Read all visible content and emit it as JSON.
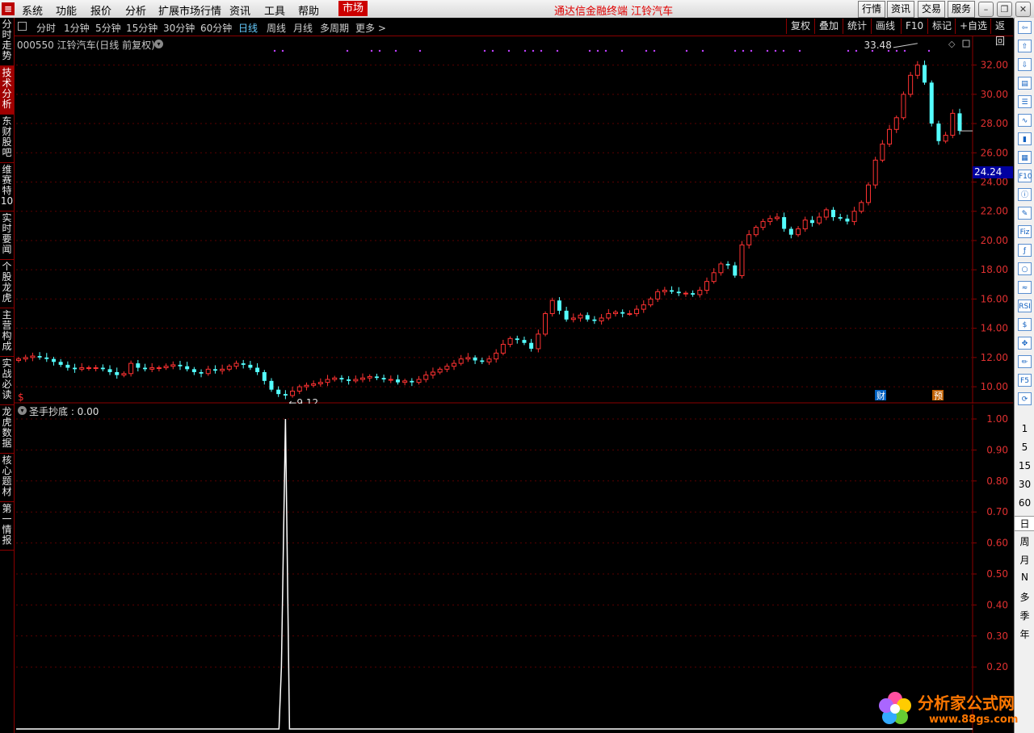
{
  "menubar": {
    "items": [
      "系统",
      "功能",
      "报价",
      "分析",
      "扩展市场行情",
      "资讯",
      "工具",
      "帮助"
    ],
    "market_tab": "市场",
    "app_title": "通达信金融终端  江铃汽车",
    "buttons": [
      "行情",
      "资讯",
      "交易",
      "服务"
    ]
  },
  "period_bar": {
    "items": [
      "分时",
      "1分钟",
      "5分钟",
      "15分钟",
      "30分钟",
      "60分钟",
      "日线",
      "周线",
      "月线",
      "多周期",
      "更多 >"
    ],
    "active": "日线",
    "right_tools": [
      "复权",
      "叠加",
      "统计",
      "画线",
      "F10",
      "标记",
      "+自选",
      "返回"
    ]
  },
  "left_tabs": [
    "分时走势",
    "技术分析",
    "东财股吧",
    "维赛特10",
    "实时要闻",
    "个股龙虎",
    "主营构成",
    "实战必读",
    "龙虎数据",
    "核心题材",
    "第一情报"
  ],
  "left_tabs_active": "技术分析",
  "stock": {
    "code_name": "000550 江铃汽车(日线 前复权)",
    "current_price_tag": "24.24",
    "high_label": "33.48",
    "low_label": "9.12",
    "markers": {
      "fin": "财",
      "pre": "预"
    },
    "dollar_icon": "$"
  },
  "indicator": {
    "title": "圣手抄底 : 0.00"
  },
  "right_toolbar": {
    "icons": [
      "back-arrow-icon",
      "up-arrow-icon",
      "down-arrow-icon",
      "report-icon",
      "list-icon",
      "chart-line-icon",
      "kline-icon",
      "grid-icon",
      "F10",
      "info-icon",
      "notes-icon",
      "Fiz",
      "fund-icon",
      "circle-icon",
      "wave-icon",
      "RSI",
      "dollar-icon",
      "move-icon",
      "pencil-icon",
      "F5",
      "refresh-icon"
    ],
    "periods": [
      "1",
      "5",
      "15",
      "30",
      "60",
      "日",
      "周",
      "月",
      "N",
      "多",
      "季",
      "年"
    ],
    "active_period": "日"
  },
  "watermark": {
    "text": "分析家公式网",
    "url": "www.88gs.com"
  },
  "chart_data": [
    {
      "type": "candlestick",
      "title": "000550 江铃汽车(日线 前复权)",
      "y_axis_ticks": [
        "32.00",
        "30.00",
        "28.00",
        "26.00",
        "24.00",
        "22.00",
        "20.00",
        "18.00",
        "16.00",
        "14.00",
        "12.00",
        "10.00"
      ],
      "ylim": [
        8.9,
        33.8
      ],
      "close_path": [
        11.9,
        12.0,
        12.1,
        12.0,
        11.9,
        11.7,
        11.5,
        11.3,
        11.2,
        11.3,
        11.3,
        11.3,
        11.2,
        11.0,
        10.8,
        10.9,
        11.6,
        11.3,
        11.2,
        11.3,
        11.3,
        11.4,
        11.5,
        11.4,
        11.2,
        11.0,
        10.9,
        11.2,
        11.1,
        11.2,
        11.4,
        11.6,
        11.5,
        11.3,
        11.0,
        10.4,
        9.8,
        9.5,
        9.4,
        9.7,
        10.0,
        10.1,
        10.2,
        10.3,
        10.5,
        10.6,
        10.5,
        10.4,
        10.5,
        10.6,
        10.7,
        10.6,
        10.5,
        10.5,
        10.3,
        10.4,
        10.3,
        10.5,
        10.8,
        11.0,
        11.2,
        11.4,
        11.6,
        11.9,
        12.0,
        11.8,
        11.7,
        11.9,
        12.3,
        12.9,
        13.3,
        13.2,
        13.0,
        12.6,
        13.6,
        15.0,
        15.9,
        15.2,
        14.6,
        14.7,
        14.9,
        14.6,
        14.5,
        14.7,
        15.0,
        15.1,
        15.0,
        15.0,
        15.3,
        15.6,
        16.0,
        16.5,
        16.6,
        16.5,
        16.4,
        16.4,
        16.3,
        16.6,
        17.2,
        17.8,
        18.4,
        18.3,
        17.6,
        19.7,
        20.4,
        20.9,
        21.3,
        21.5,
        21.6,
        20.8,
        20.4,
        20.8,
        21.4,
        21.2,
        21.6,
        22.1,
        21.6,
        21.5,
        21.3,
        22.0,
        22.6,
        23.8,
        25.5,
        26.6,
        27.6,
        28.4,
        30.0,
        31.3,
        32.0,
        30.8,
        28.0,
        26.8,
        27.2,
        28.7,
        27.5
      ],
      "last_visible_close": 24.24,
      "annotations": [
        "33.48",
        "9.12"
      ]
    },
    {
      "type": "line",
      "title": "圣手抄底 : 0.00",
      "y_axis_ticks": [
        "1.00",
        "0.90",
        "0.80",
        "0.70",
        "0.60",
        "0.50",
        "0.40",
        "0.30",
        "0.20"
      ],
      "ylim": [
        0.0,
        1.0
      ],
      "spike_index": 38,
      "spike_value": 1.0,
      "baseline_value": 0.0
    }
  ]
}
